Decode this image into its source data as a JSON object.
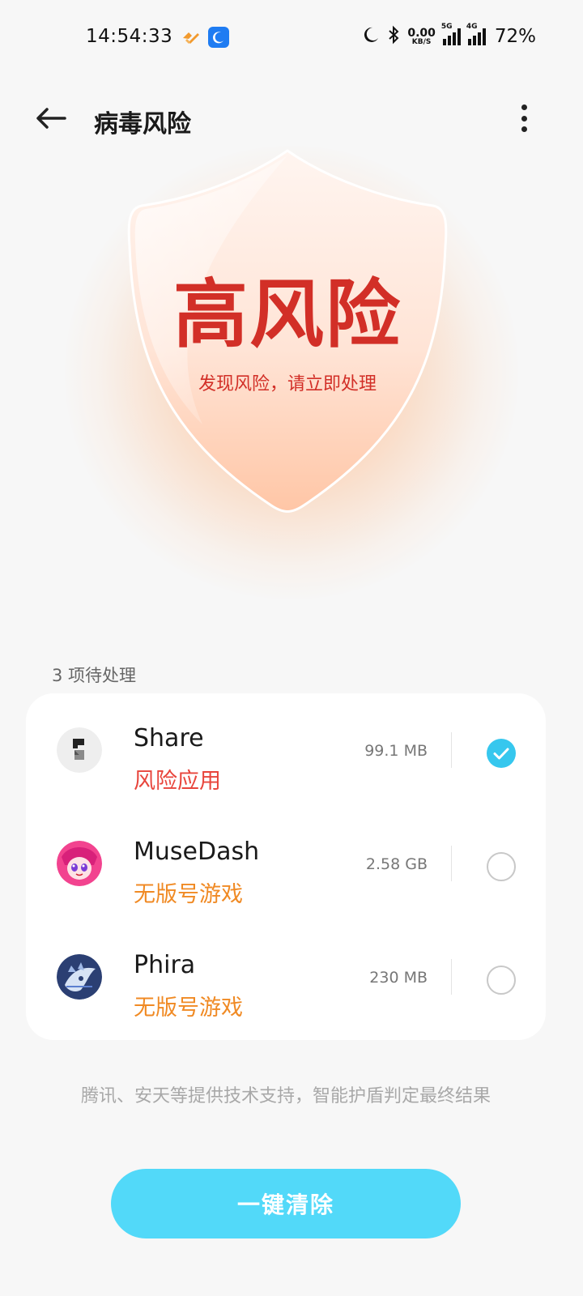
{
  "status_bar": {
    "time": "14:54:33",
    "net_speed_value": "0.00",
    "net_speed_unit": "KB/S",
    "signal_1_label": "5G",
    "signal_2_label": "4G",
    "battery": "72%",
    "icons": [
      "notification-app-icon",
      "notification-moon-app-icon",
      "moon-icon",
      "bluetooth-icon",
      "signal-icon",
      "signal-icon"
    ]
  },
  "header": {
    "title": "病毒风险",
    "back_icon": "arrow-left-icon",
    "more_icon": "more-vertical-icon"
  },
  "shield": {
    "level": "高风险",
    "message": "发现风险，请立即处理",
    "accent": "#d22f27"
  },
  "list": {
    "pending_label": "3 项待处理",
    "items": [
      {
        "name": "Share",
        "tag": "风险应用",
        "tag_color": "#e8453c",
        "size": "99.1 MB",
        "checked": true
      },
      {
        "name": "MuseDash",
        "tag": "无版号游戏",
        "tag_color": "#f08a24",
        "size": "2.58 GB",
        "checked": false
      },
      {
        "name": "Phira",
        "tag": "无版号游戏",
        "tag_color": "#f08a24",
        "size": "230 MB",
        "checked": false
      }
    ]
  },
  "footnote": "腾讯、安天等提供技术支持，智能护盾判定最终结果",
  "action": {
    "label": "一键清除",
    "color": "#52d9f9"
  }
}
